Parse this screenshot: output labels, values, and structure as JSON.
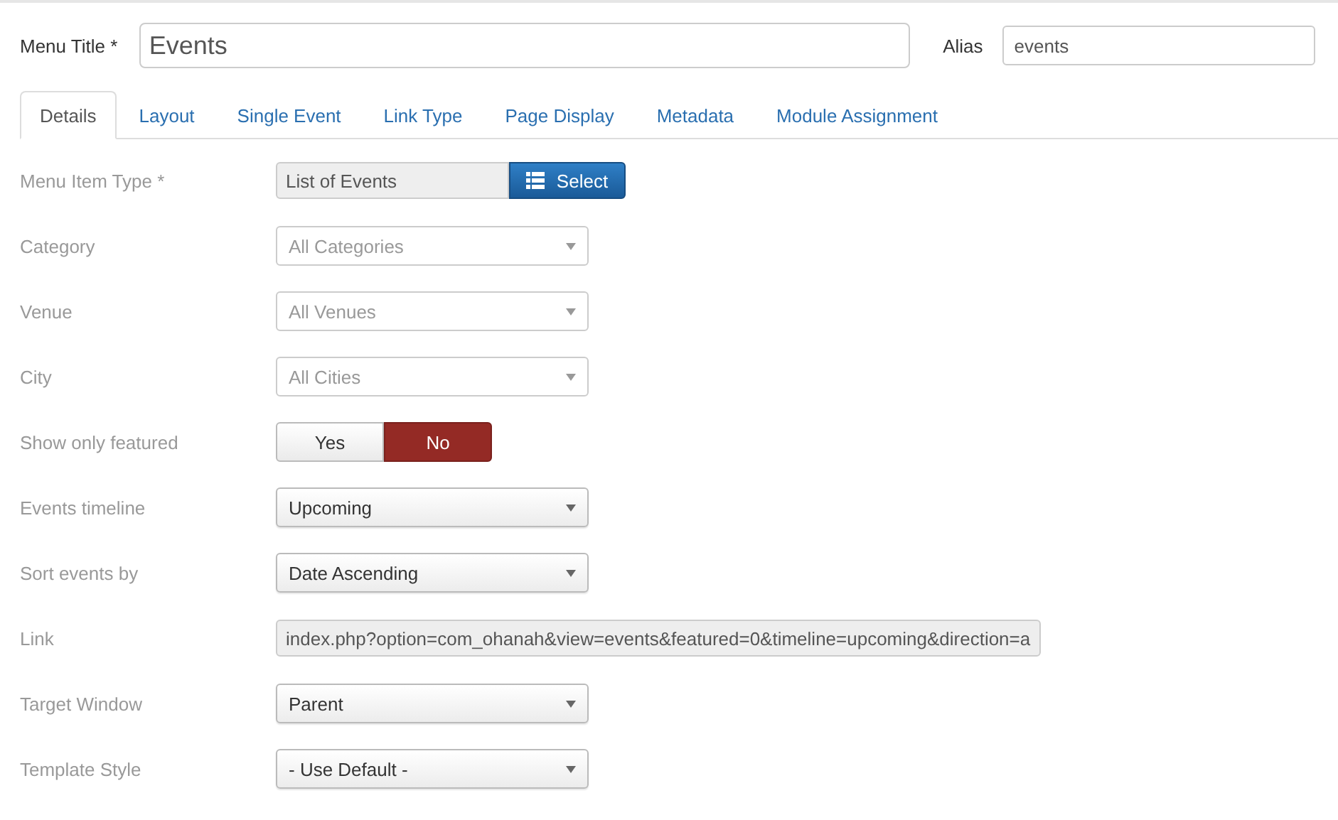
{
  "header": {
    "title_label": "Menu Title *",
    "title_value": "Events",
    "alias_label": "Alias",
    "alias_value": "events"
  },
  "tabs": [
    {
      "label": "Details",
      "selected": true
    },
    {
      "label": "Layout",
      "selected": false
    },
    {
      "label": "Single Event",
      "selected": false
    },
    {
      "label": "Link Type",
      "selected": false
    },
    {
      "label": "Page Display",
      "selected": false
    },
    {
      "label": "Metadata",
      "selected": false
    },
    {
      "label": "Module Assignment",
      "selected": false
    }
  ],
  "fields": [
    {
      "kind": "type",
      "label": "Menu Item Type *",
      "value": "List of Events",
      "button": "Select"
    },
    {
      "kind": "chosen",
      "label": "Category",
      "value": "All Categories"
    },
    {
      "kind": "chosen",
      "label": "Venue",
      "value": "All Venues"
    },
    {
      "kind": "chosen",
      "label": "City",
      "value": "All Cities"
    },
    {
      "kind": "toggle",
      "label": "Show only featured",
      "options": [
        {
          "label": "Yes",
          "selected": false
        },
        {
          "label": "No",
          "selected": true
        }
      ]
    },
    {
      "kind": "dropdown",
      "label": "Events timeline",
      "value": "Upcoming"
    },
    {
      "kind": "dropdown",
      "label": "Sort events by",
      "value": "Date Ascending"
    },
    {
      "kind": "readonly",
      "label": "Link",
      "value": "index.php?option=com_ohanah&view=events&featured=0&timeline=upcoming&direction=a"
    },
    {
      "kind": "dropdown",
      "label": "Target Window",
      "value": "Parent"
    },
    {
      "kind": "dropdown",
      "label": "Template Style",
      "value": "- Use Default -"
    }
  ]
}
